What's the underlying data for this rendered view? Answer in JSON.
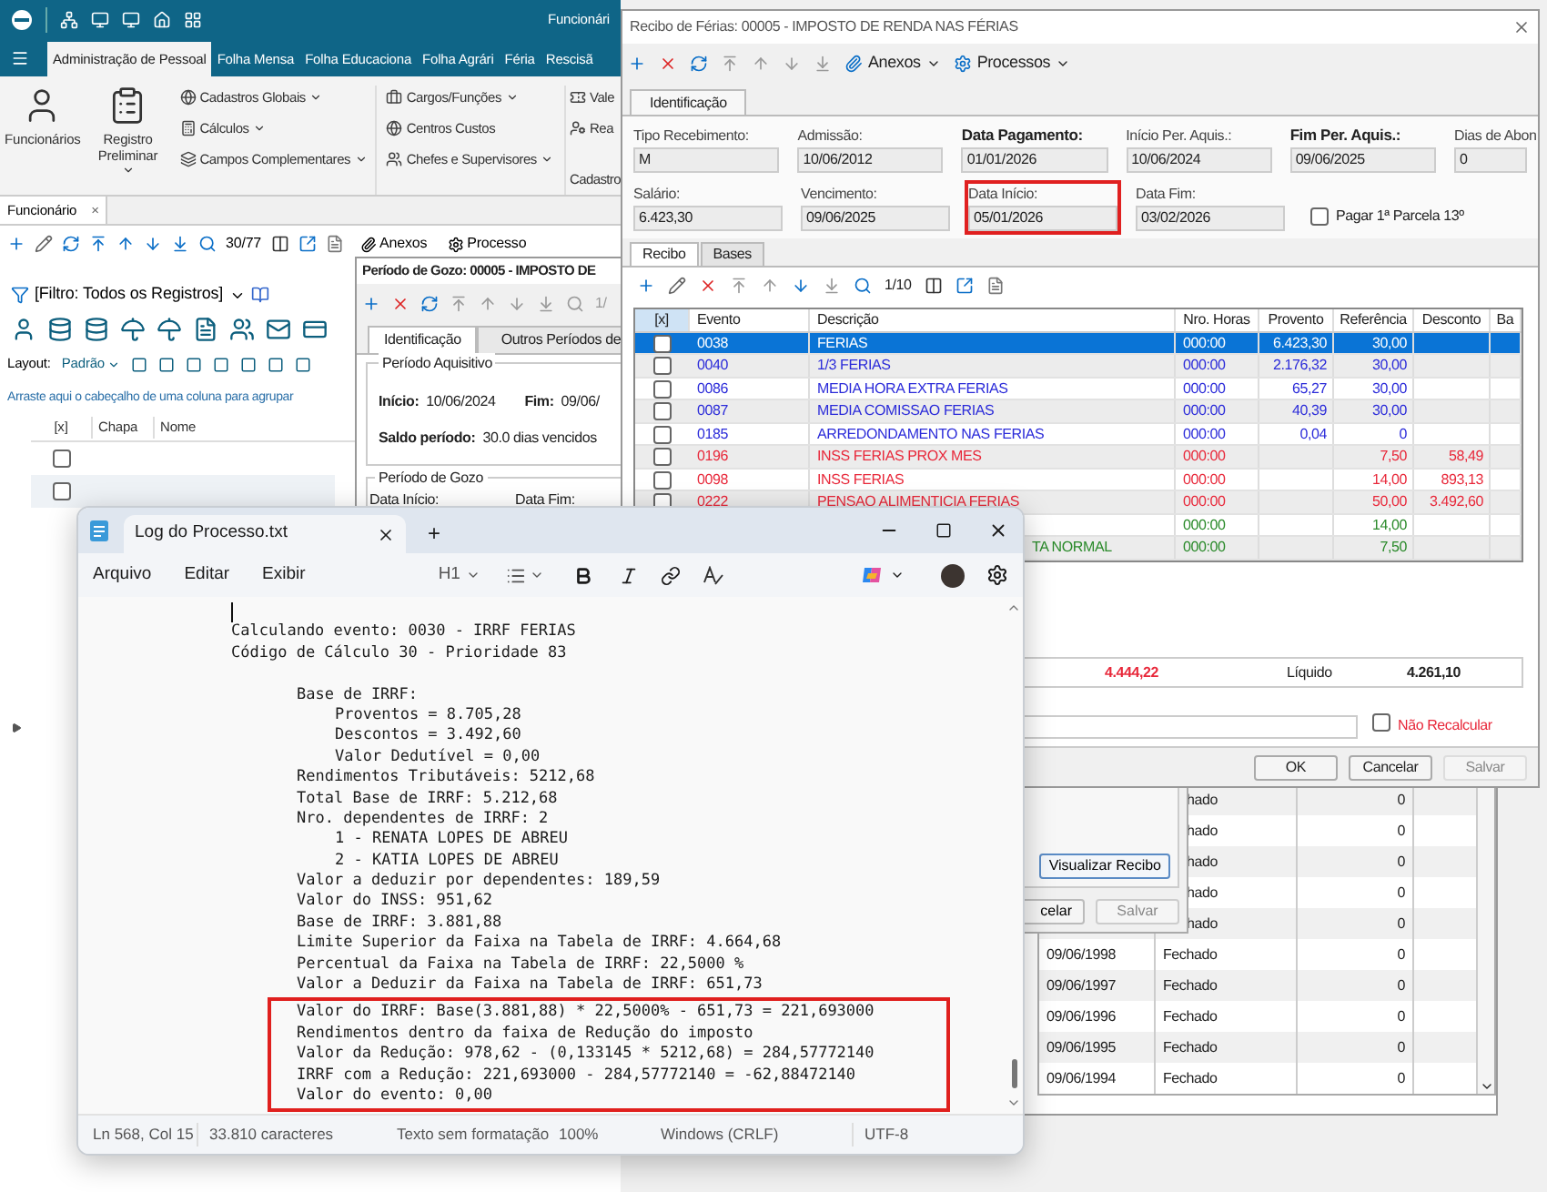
{
  "main_app": {
    "quick_bar": {
      "title": "Funcionári"
    },
    "ribbon_tabs": [
      {
        "label": "Administração de Pessoal",
        "selected": true
      },
      {
        "label": "Folha Mensa",
        "selected": false
      },
      {
        "label": "Folha Educaciona",
        "selected": false
      },
      {
        "label": "Folha Agrári",
        "selected": false
      },
      {
        "label": "Féria",
        "selected": false
      },
      {
        "label": "Rescisã",
        "selected": false
      }
    ],
    "ribbon": {
      "large_buttons": [
        {
          "label": "Funcionários",
          "dropdown": false
        },
        {
          "label": "Registro Preliminar",
          "dropdown": true
        }
      ],
      "columns": [
        [
          {
            "label": "Cadastros Globais",
            "dropdown": true
          },
          {
            "label": "Cálculos",
            "dropdown": true
          },
          {
            "label": "Campos Complementares",
            "dropdown": true
          }
        ],
        [
          {
            "label": "Cargos/Funções",
            "dropdown": true
          },
          {
            "label": "Centros Custos",
            "dropdown": false
          },
          {
            "label": "Chefes e Supervisores",
            "dropdown": true
          }
        ],
        [
          {
            "label": "Vale",
            "dropdown": false
          },
          {
            "label": "Rea",
            "dropdown": false
          }
        ]
      ],
      "group_label": "Cadastro"
    },
    "document_tab": {
      "label": "Funcionário",
      "close": "×"
    },
    "toolbar": {
      "record_counter": "30/77",
      "attachments": "Anexos",
      "processes": "Processo"
    },
    "filter": {
      "label": "[Filtro: Todos os Registros]"
    },
    "layout": {
      "label": "Layout:",
      "value": "Padrão"
    },
    "group_hint": "Arraste aqui o cabeçalho de uma coluna para agrupar",
    "grid": {
      "columns": [
        "[x]",
        "Chapa",
        "Nome"
      ],
      "rows": [
        {
          "checked": false
        },
        {
          "checked": false
        }
      ]
    }
  },
  "period_window": {
    "title": "Período de Gozo: 00005 - IMPOSTO DE",
    "record_counter": "1/",
    "tabs": [
      {
        "label": "Identificação",
        "selected": true
      },
      {
        "label": "Outros Períodos de",
        "selected": false
      }
    ],
    "acquisition": {
      "title": "Período Aquisitivo",
      "start_label": "Início:",
      "start": "10/06/2024",
      "end_label": "Fim:",
      "end": "09/06/",
      "balance_label": "Saldo período:",
      "balance": "30.0 dias vencidos"
    },
    "enjoyment": {
      "title": "Período de Gozo",
      "start_label": "Data Início:",
      "end_label": "Data Fim:"
    },
    "grid_rows": [
      {
        "covered": true,
        "status": "hado",
        "value": "0"
      },
      {
        "covered": true,
        "status": "hado",
        "value": "0"
      },
      {
        "covered": true,
        "status": "hado",
        "value": "0"
      },
      {
        "covered": true,
        "status": "hado",
        "value": "0"
      },
      {
        "covered": true,
        "status": "hado",
        "value": "0"
      },
      {
        "covered": false,
        "date": "09/06/1998",
        "status": "Fechado",
        "value": "0"
      },
      {
        "covered": false,
        "date": "09/06/1997",
        "status": "Fechado",
        "value": "0"
      },
      {
        "covered": false,
        "date": "09/06/1996",
        "status": "Fechado",
        "value": "0"
      },
      {
        "covered": false,
        "date": "09/06/1995",
        "status": "Fechado",
        "value": "0"
      },
      {
        "covered": false,
        "date": "09/06/1994",
        "status": "Fechado",
        "value": "0"
      }
    ]
  },
  "sub_dialog": {
    "view_button": "Visualizar Recibo",
    "cancel_button": "celar",
    "save_button": "Salvar"
  },
  "receipt_window": {
    "title": "Recibo de Férias: 00005 - IMPOSTO DE RENDA NAS FÉRIAS",
    "attachments": "Anexos",
    "processes": "Processos",
    "tab": "Identificação",
    "fields": [
      [
        {
          "label": "Tipo Recebimento:",
          "value": "M",
          "bold": false,
          "highlighted": false
        },
        {
          "label": "Admissão:",
          "value": "10/06/2012",
          "bold": false,
          "highlighted": false
        },
        {
          "label": "Data Pagamento:",
          "value": "01/01/2026",
          "bold": true,
          "highlighted": false
        },
        {
          "label": "Início Per. Aquis.:",
          "value": "10/06/2024",
          "bold": false,
          "highlighted": false
        },
        {
          "label": "Fim Per. Aquis.:",
          "value": "09/06/2025",
          "bold": true,
          "highlighted": false
        },
        {
          "label": "Dias de Abon",
          "value": "0",
          "bold": false,
          "highlighted": false
        }
      ],
      [
        {
          "label": "Salário:",
          "value": "6.423,30",
          "bold": false,
          "highlighted": false
        },
        {
          "label": "Vencimento:",
          "value": "09/06/2025",
          "bold": false,
          "highlighted": false
        },
        {
          "label": "Data Início:",
          "value": "05/01/2026",
          "bold": false,
          "highlighted": true
        },
        {
          "label": "Data Fim:",
          "value": "03/02/2026",
          "bold": false,
          "highlighted": false
        }
      ]
    ],
    "installment_checkbox": {
      "label": "Pagar 1ª Parcela 13º",
      "checked": false
    },
    "subtabs": [
      {
        "label": "Recibo",
        "selected": true
      },
      {
        "label": "Bases",
        "selected": false
      }
    ],
    "record_counter": "1/10",
    "columns": [
      "[x]",
      "Evento",
      "Descrição",
      "Nro. Horas",
      "Provento",
      "Referência",
      "Desconto",
      "Ba"
    ],
    "rows": [
      {
        "kind": "full",
        "selected": true,
        "checked": false,
        "event": "0038",
        "description": "FERIAS",
        "hours": "000:00",
        "earning": "6.423,30",
        "reference": "30,00"
      },
      {
        "kind": "full",
        "selected": false,
        "checked": false,
        "color": "#2b2bd9",
        "event": "0040",
        "description": "1/3 FERIAS",
        "hours": "000:00",
        "earning": "2.176,32",
        "reference": "30,00"
      },
      {
        "kind": "full",
        "selected": false,
        "checked": false,
        "color": "#2b2bd9",
        "event": "0086",
        "description": "MEDIA HORA EXTRA FERIAS",
        "hours": "000:00",
        "earning": "65,27",
        "reference": "30,00"
      },
      {
        "kind": "full",
        "selected": false,
        "checked": false,
        "color": "#2b2bd9",
        "event": "0087",
        "description": "MEDIA COMISSAO FERIAS",
        "hours": "000:00",
        "earning": "40,39",
        "reference": "30,00"
      },
      {
        "kind": "full",
        "selected": false,
        "checked": false,
        "color": "#2b2bd9",
        "event": "0185",
        "description": "ARREDONDAMENTO NAS FERIAS",
        "hours": "000:00",
        "earning": "0,04",
        "reference": "0"
      },
      {
        "kind": "full",
        "selected": false,
        "checked": false,
        "color": "#e8283a",
        "event": "0196",
        "description": "INSS FERIAS PROX MES",
        "hours": "000:00",
        "reference": "7,50",
        "deduction": "58,49"
      },
      {
        "kind": "full",
        "selected": false,
        "checked": false,
        "color": "#e8283a",
        "event": "0098",
        "description": "INSS FERIAS",
        "hours": "000:00",
        "reference": "14,00",
        "deduction": "893,13"
      },
      {
        "kind": "full",
        "selected": false,
        "checked": false,
        "color": "#e8283a",
        "event": "0222",
        "description": "PENSAO ALIMENTICIA  FERIAS",
        "hours": "000:00",
        "reference": "50,00",
        "deduction": "3.492,60"
      },
      {
        "kind": "covered",
        "selected": false,
        "color": "#2a8a2a",
        "hours": "000:00",
        "reference": "14,00"
      },
      {
        "kind": "covered",
        "selected": false,
        "color": "#2a8a2a",
        "description": "TA NORMAL",
        "hours": "000:00",
        "reference": "7,50"
      }
    ],
    "totals": {
      "deductions": "4.444,22",
      "net_label": "Líquido",
      "net": "4.261,10"
    },
    "no_recalc_checkbox": {
      "label": "Não Recalcular",
      "checked": false
    },
    "buttons": [
      {
        "label": "OK",
        "disabled": false
      },
      {
        "label": "Cancelar",
        "disabled": false
      },
      {
        "label": "Salvar",
        "disabled": true
      }
    ]
  },
  "notepad": {
    "tab_title": "Log do Processo.txt",
    "new_tab": "+",
    "menus": [
      "Arquivo",
      "Editar",
      "Exibir"
    ],
    "heading_select": "H1",
    "lines": [
      {
        "text": "Calculando evento: 0030 - IRRF FERIAS"
      },
      {
        "text": "Código de Cálculo 30 - Prioridade 83",
        "children": [
          {
            "text": "Base de IRRF:",
            "children": [
              {
                "text": "Proventos = 8.705,28"
              },
              {
                "text": "Descontos = 3.492,60"
              },
              {
                "text": "Valor Dedutível = 0,00"
              }
            ]
          },
          {
            "text": "Rendimentos Tributáveis: 5212,68"
          },
          {
            "text": "Total Base de IRRF: 5.212,68"
          },
          {
            "text": "Nro. dependentes de IRRF: 2",
            "children": [
              {
                "text": "1 - RENATA LOPES DE ABREU"
              },
              {
                "text": "2 - KATIA LOPES DE ABREU"
              }
            ]
          },
          {
            "text": "Valor a deduzir por dependentes: 189,59"
          },
          {
            "text": "Valor do INSS: 951,62"
          },
          {
            "text": "Base de IRRF: 3.881,88"
          },
          {
            "text": "Limite Superior da Faixa na Tabela de IRRF: 4.664,68"
          },
          {
            "text": "Percentual da Faixa na Tabela de IRRF: 22,5000 %"
          },
          {
            "text": "Valor a Deduzir da Faixa na Tabela de IRRF: 651,73"
          }
        ]
      }
    ],
    "highlight_box": {
      "lines": [
        "Valor do IRRF: Base(3.881,88) * 22,5000% - 651,73 = 221,693000",
        "Rendimentos dentro da faixa de Redução do imposto",
        "Valor da Redução: 978,62 - (0,133145 * 5212,68) = 284,57772140",
        "IRRF com a Redução: 221,693000 - 284,57772140 = -62,88472140",
        "Valor do evento: 0,00"
      ]
    },
    "status_bar": [
      "Ln 568, Col 15",
      "33.810 caracteres",
      "Texto sem formatação",
      "100%",
      "Windows (CRLF)",
      "UTF-8"
    ]
  }
}
